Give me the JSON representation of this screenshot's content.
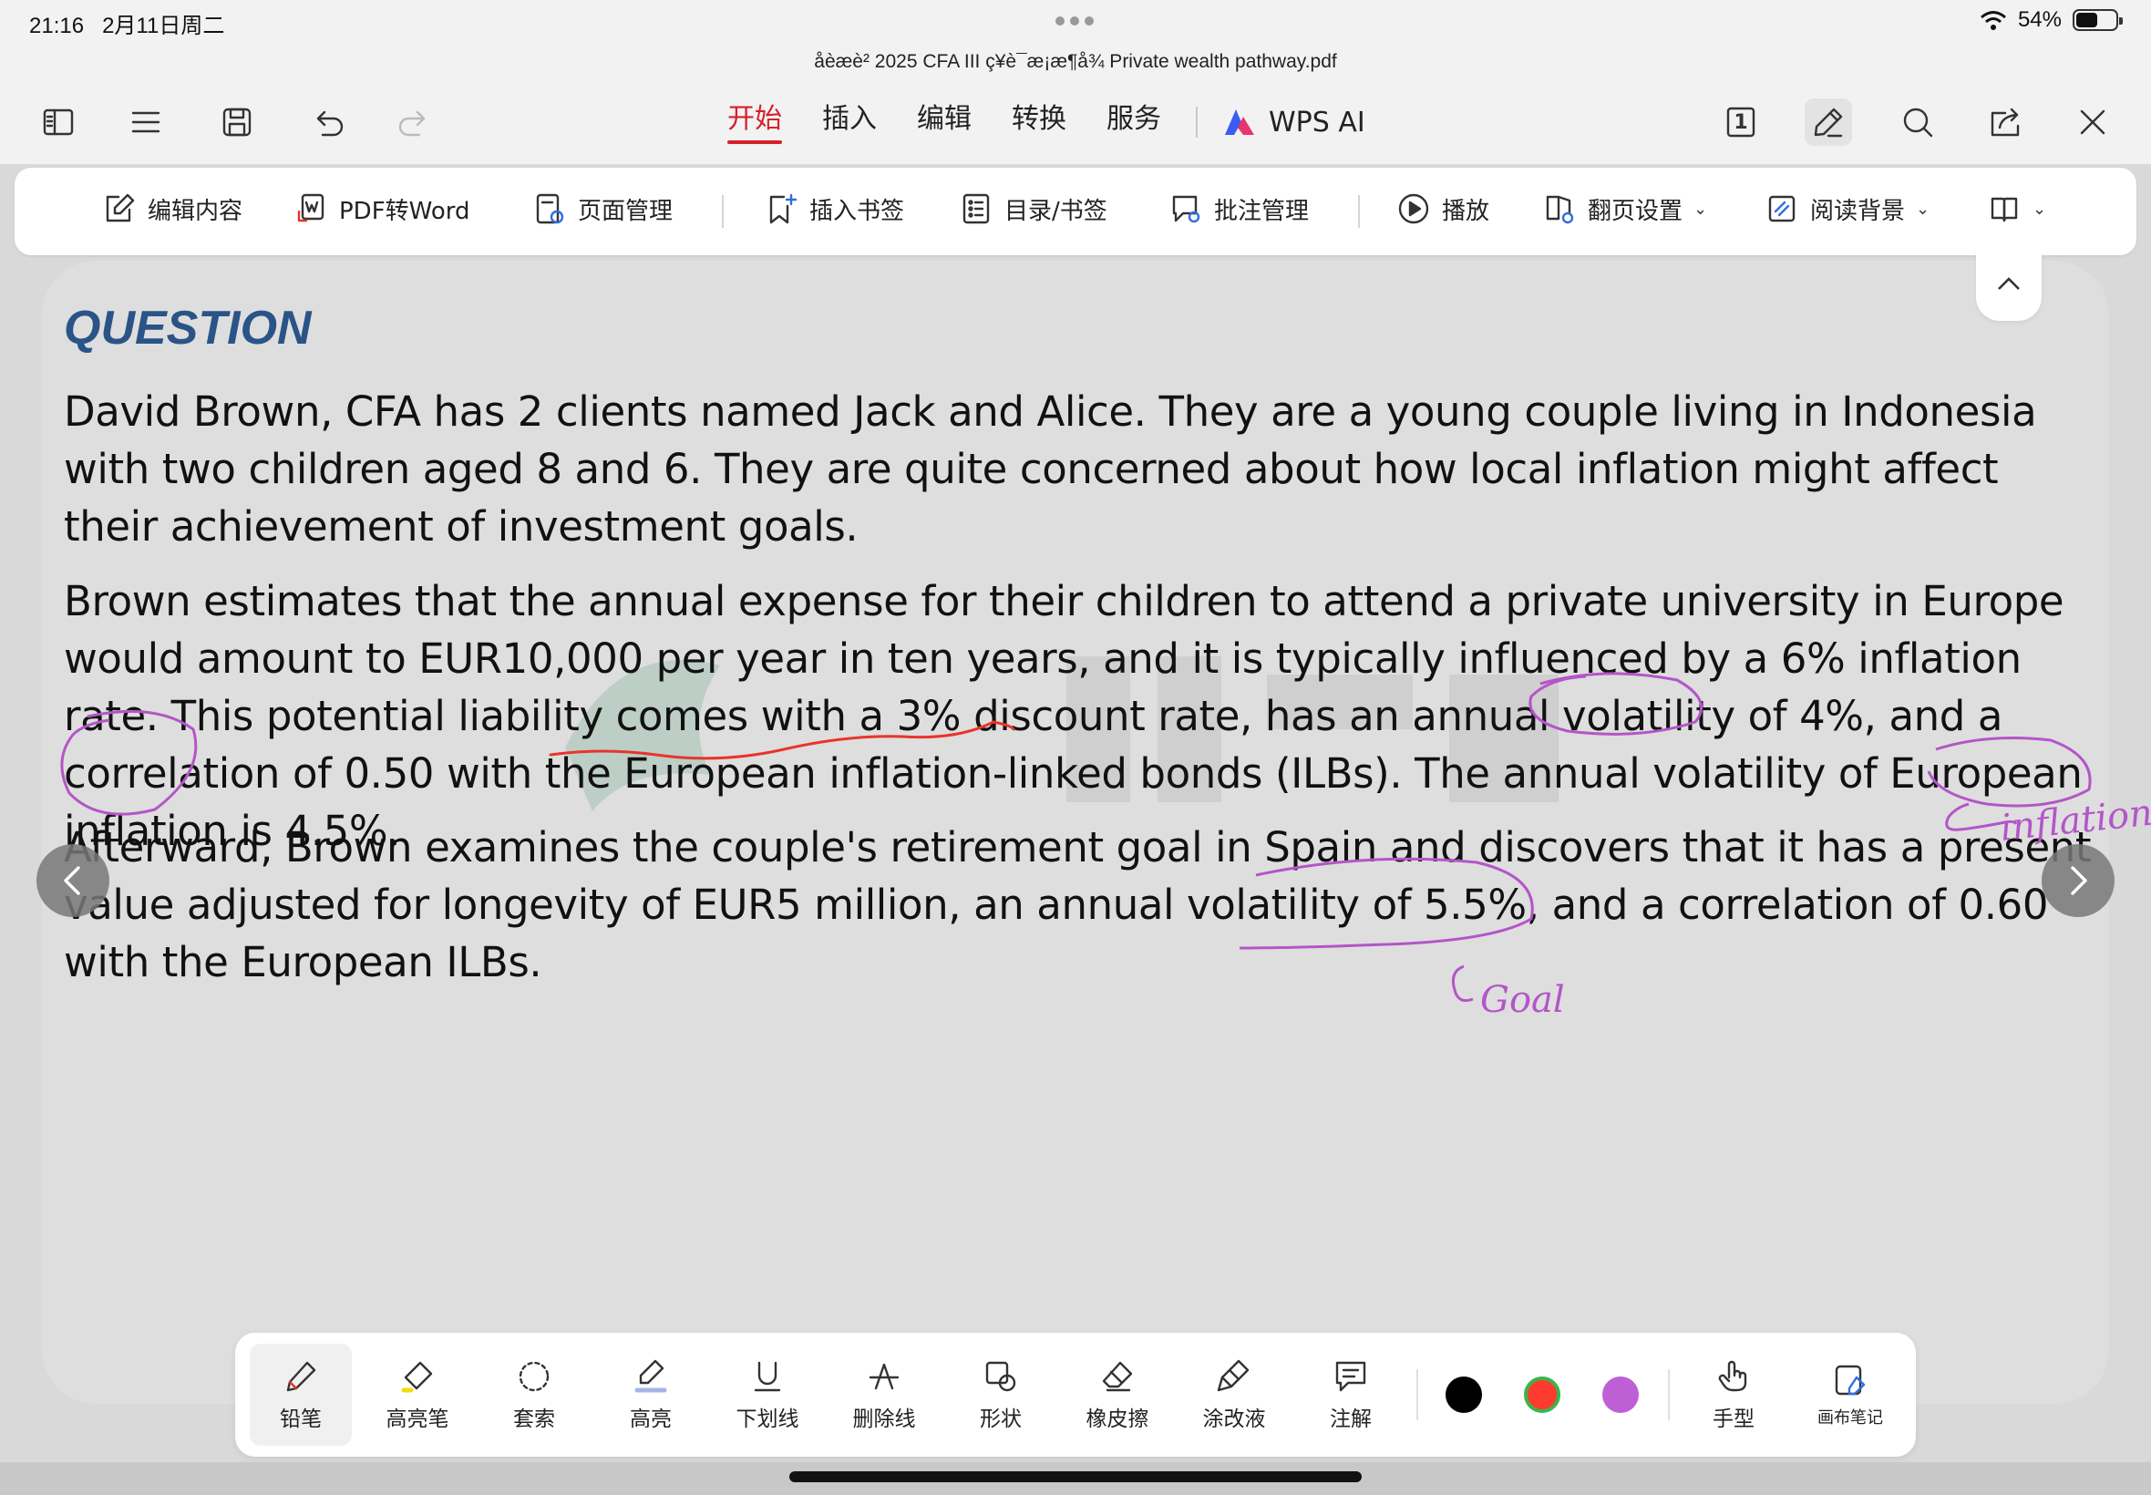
{
  "status": {
    "time": "21:16",
    "date": "2月11日周二",
    "battery": "54%",
    "battery_level": 0.54
  },
  "title": "åèæè² 2025 CFA III ç¥è¯æ¡æ¶å¾ Private wealth pathway.pdf",
  "menu": {
    "tabs": [
      {
        "label": "开始",
        "active": true
      },
      {
        "label": "插入",
        "active": false
      },
      {
        "label": "编辑",
        "active": false
      },
      {
        "label": "转换",
        "active": false
      },
      {
        "label": "服务",
        "active": false
      }
    ],
    "wps_ai": "WPS AI",
    "page_number": "1"
  },
  "ribbon": {
    "edit_content": "编辑内容",
    "pdf_to_word": "PDF转Word",
    "page_manage": "页面管理",
    "insert_bookmark": "插入书签",
    "toc_bookmark": "目录/书签",
    "annotation_manage": "批注管理",
    "play": "播放",
    "page_turn_settings": "翻页设置",
    "reading_background": "阅读背景"
  },
  "document": {
    "heading": "QUESTION",
    "paragraphs": [
      "David Brown, CFA has 2 clients named Jack and Alice. They are a young couple living in Indonesia with two children aged 8 and 6. They are quite concerned about how local inflation might affect their achievement of investment goals.",
      "Brown estimates that the annual expense for their children to attend a private university in Europe would amount to EUR10,000 per year in ten years, and it is typically influenced by a 6% inflation rate. This potential liability comes with a 3% discount rate, has an annual volatility of 4%, and a correlation of 0.50 with the European inflation-linked bonds (ILBs). The annual volatility of European inflation is 4.5%.",
      "Afterward, Brown examines the couple's retirement goal in Spain and discovers that it has a present value adjusted for longevity of EUR5 million, an annual volatility of 5.5%, and a correlation of 0.60 with the European ILBs."
    ],
    "handwriting": {
      "inflation_note": "inflation",
      "goal_note": "Goal"
    }
  },
  "pen_toolbar": {
    "tools": [
      {
        "label": "铅笔",
        "icon": "pencil-icon",
        "selected": true
      },
      {
        "label": "高亮笔",
        "icon": "highlighter-icon",
        "selected": false
      },
      {
        "label": "套索",
        "icon": "lasso-icon",
        "selected": false
      },
      {
        "label": "高亮",
        "icon": "highlight-icon",
        "selected": false
      },
      {
        "label": "下划线",
        "icon": "underline-icon",
        "selected": false
      },
      {
        "label": "删除线",
        "icon": "strikethrough-icon",
        "selected": false
      },
      {
        "label": "形状",
        "icon": "shape-icon",
        "selected": false
      },
      {
        "label": "橡皮擦",
        "icon": "eraser-icon",
        "selected": false
      },
      {
        "label": "涂改液",
        "icon": "correction-icon",
        "selected": false
      },
      {
        "label": "注解",
        "icon": "note-icon",
        "selected": false
      }
    ],
    "colors": [
      "#000000",
      "#ff3b30",
      "#bf5fd6"
    ],
    "hand": "手型",
    "canvas_note": "画布笔记"
  },
  "colors": {
    "accent": "#d6202b",
    "heading": "#2a5487",
    "ink_purple": "#b455c8",
    "ink_red": "#e8352a"
  }
}
